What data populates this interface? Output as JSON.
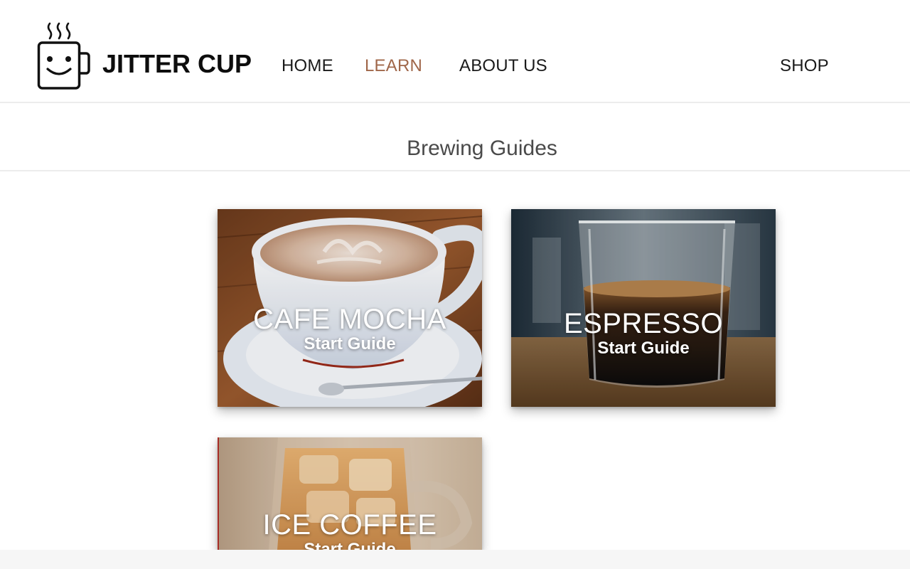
{
  "header": {
    "brand": "JITTER CUP",
    "logo_icon": "smiling-coffee-cup-icon",
    "nav": {
      "home": "HOME",
      "learn": "LEARN",
      "about": "ABOUT US",
      "shop": "SHOP"
    },
    "active_nav": "LEARN",
    "accent_color": "#a0674a"
  },
  "subheader": {
    "title": "Brewing Guides"
  },
  "guides": [
    {
      "title": "CAFE MOCHA",
      "action": "Start Guide"
    },
    {
      "title": "ESPRESSO",
      "action": "Start Guide"
    },
    {
      "title": "ICE COFFEE",
      "action": "Start Guide"
    }
  ]
}
